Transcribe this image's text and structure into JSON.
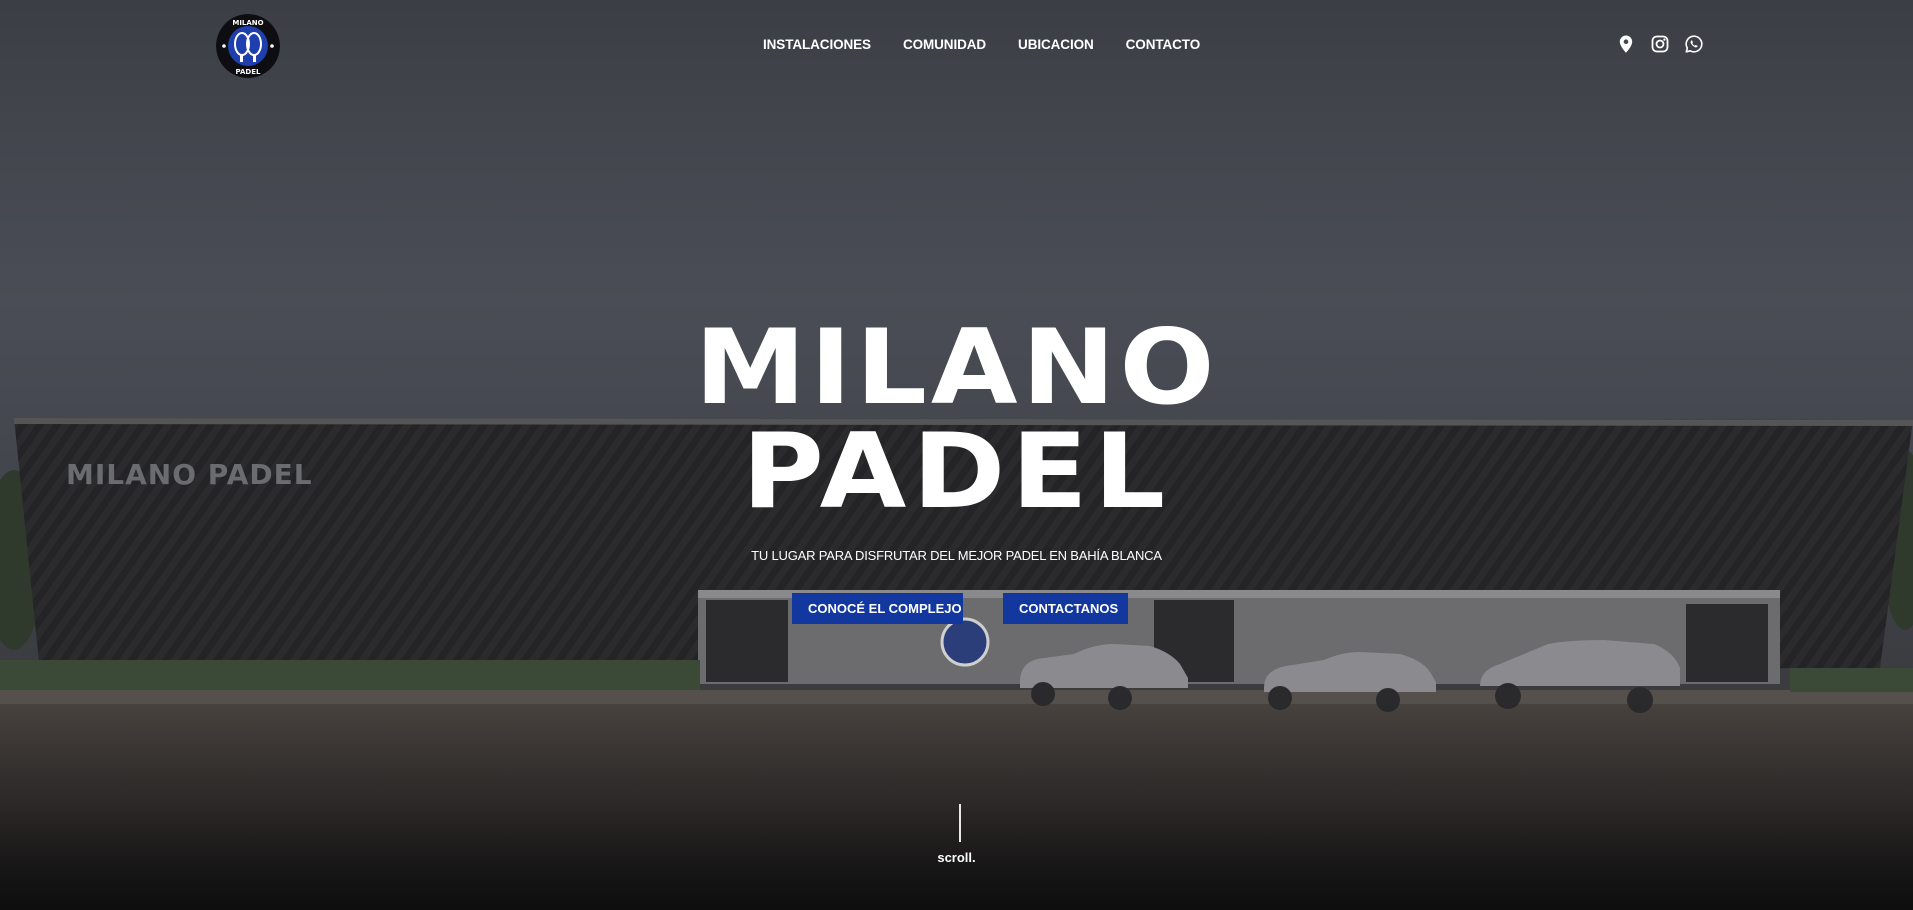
{
  "brand": {
    "name": "Milano Padel",
    "logo_text_top": "MILANO",
    "logo_text_bottom": "PADEL",
    "accent_color": "#1238a0"
  },
  "nav": {
    "items": [
      {
        "label": "INSTALACIONES"
      },
      {
        "label": "COMUNIDAD"
      },
      {
        "label": "UBICACION"
      },
      {
        "label": "CONTACTO"
      }
    ]
  },
  "socials": [
    {
      "icon": "map-pin-icon"
    },
    {
      "icon": "instagram-icon"
    },
    {
      "icon": "whatsapp-icon"
    }
  ],
  "hero": {
    "title_line1": "MILANO",
    "title_line2": "PADEL",
    "tagline": "TU LUGAR PARA DISFRUTAR DEL MEJOR PADEL EN BAHÍA BLANCA",
    "primary_button": "CONOCÉ EL COMPLEJO",
    "secondary_button": "CONTACTANOS",
    "building_sign": "MILANO PADEL",
    "scroll_label": "scroll."
  }
}
